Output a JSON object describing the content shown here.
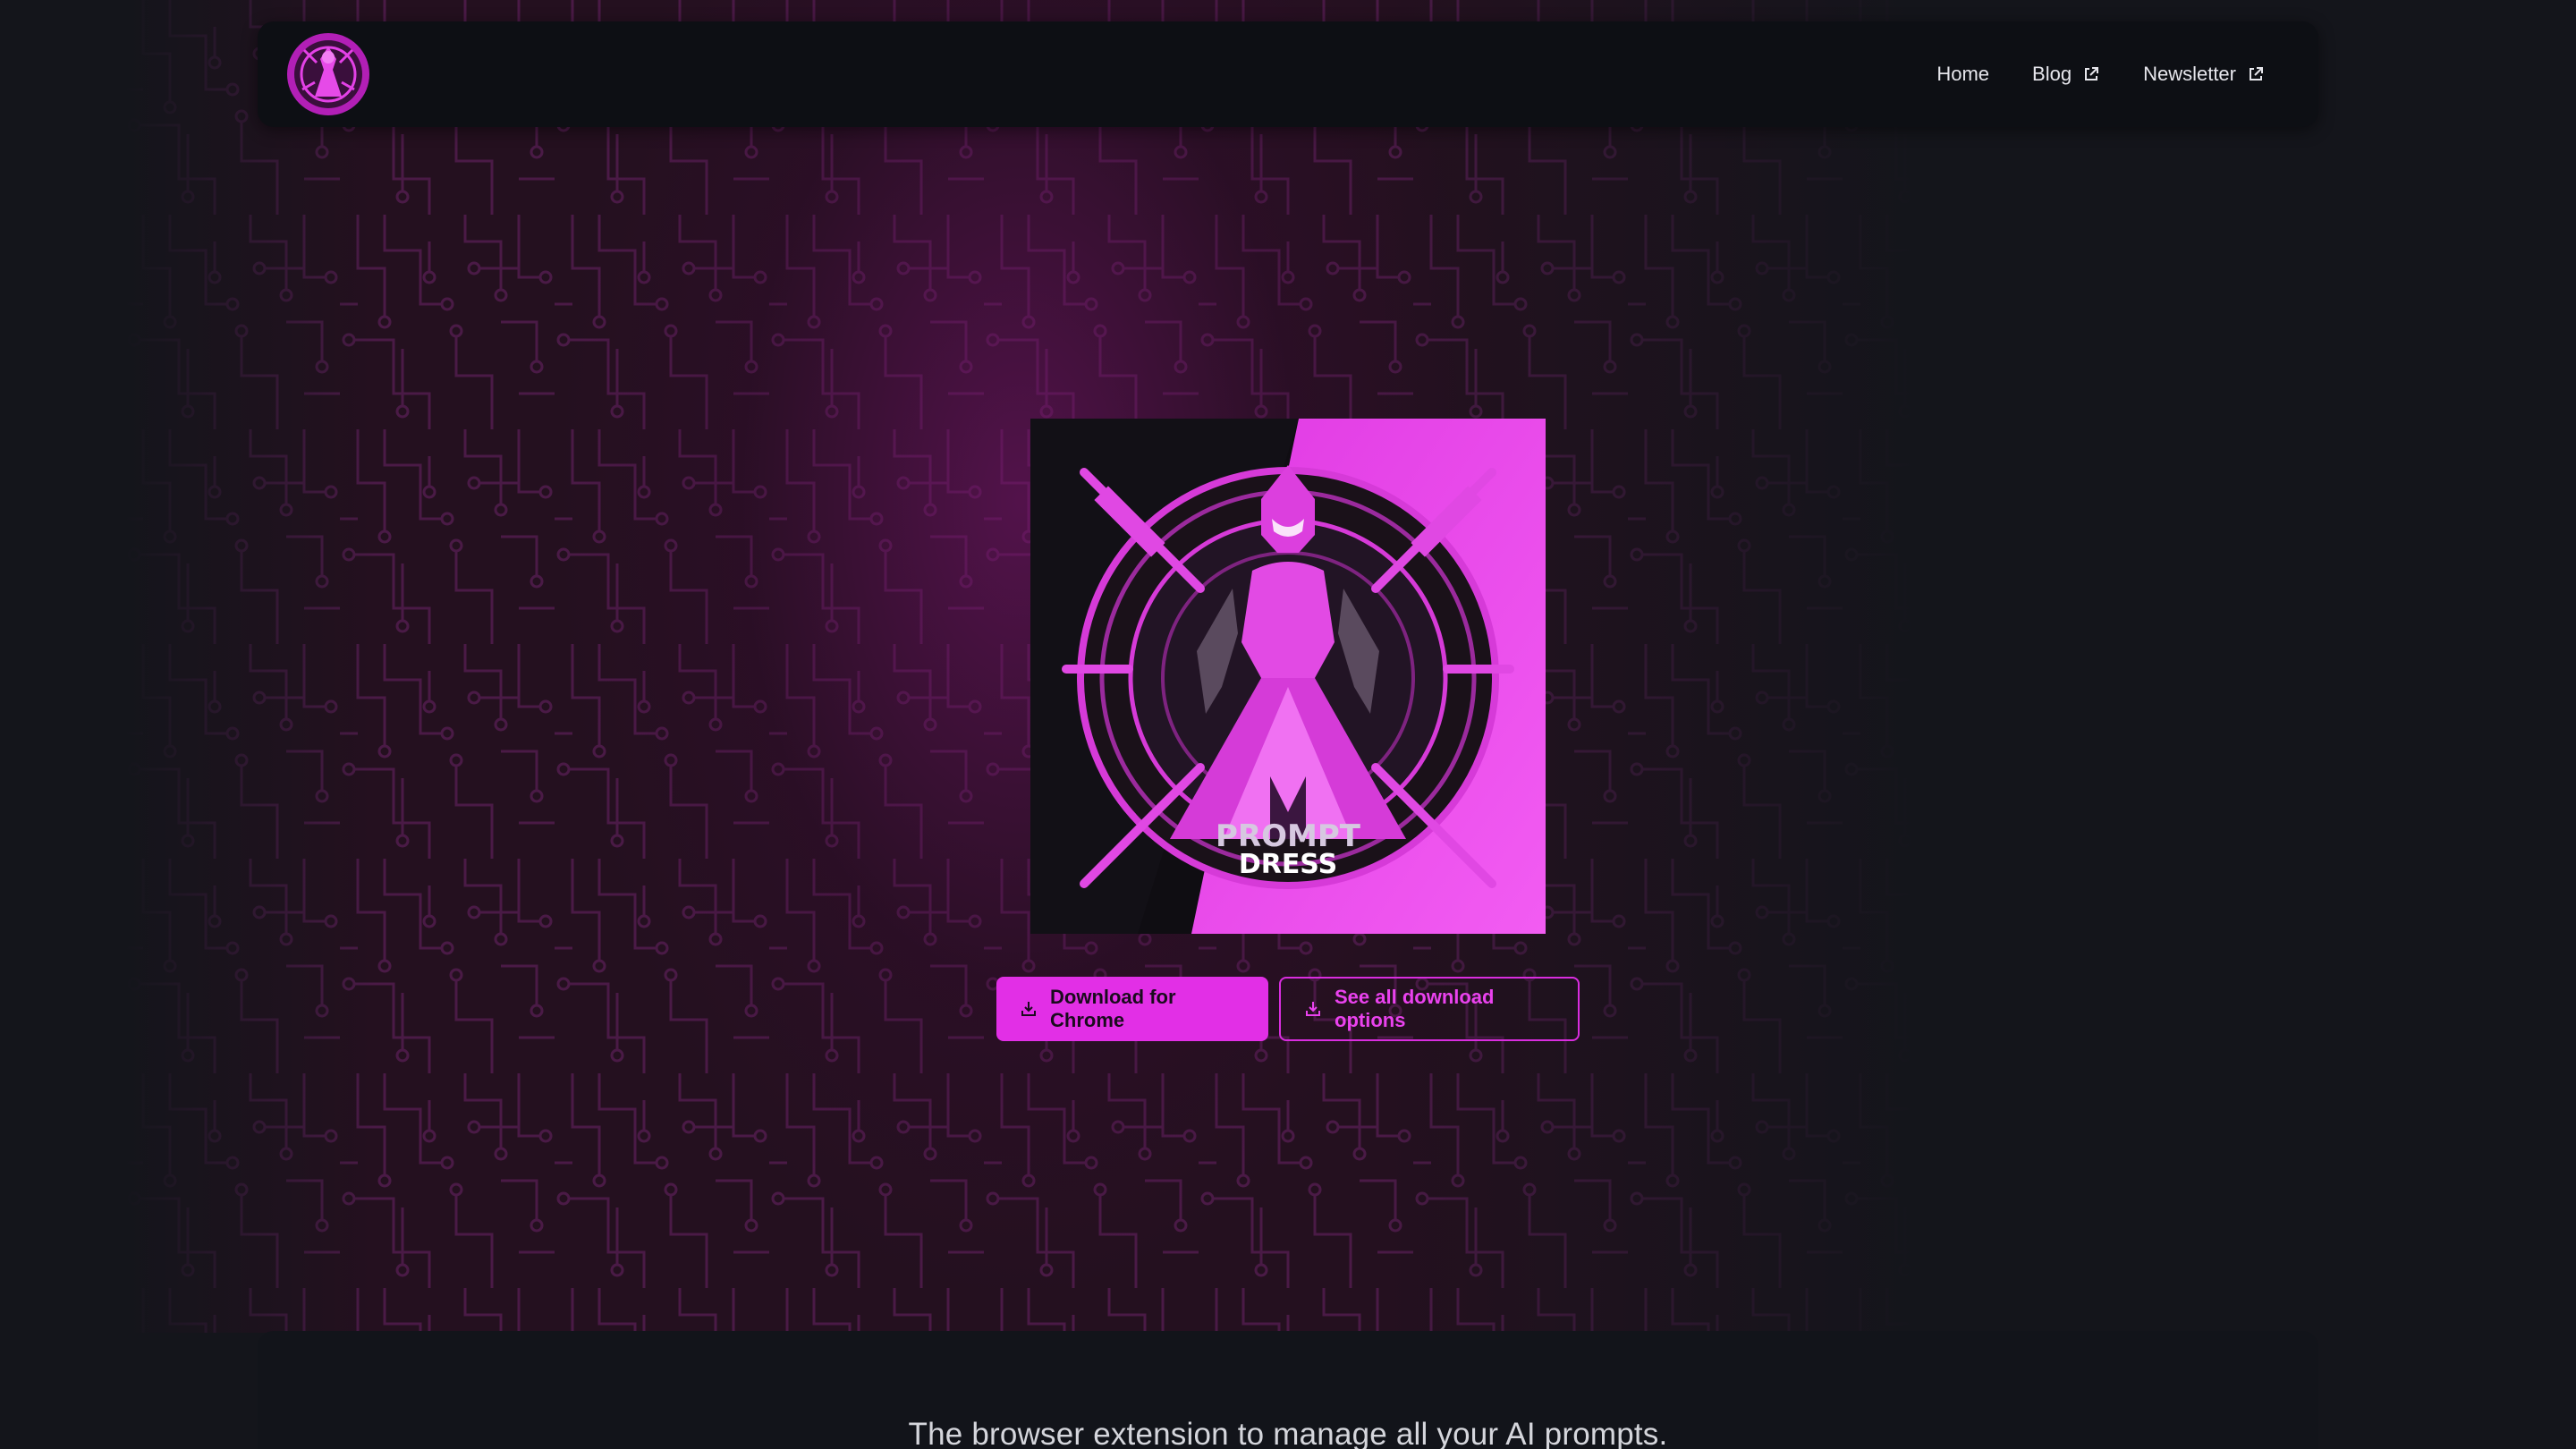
{
  "nav": {
    "logo_name": "prompt-dress-logo",
    "links": [
      {
        "label": "Home",
        "external": false
      },
      {
        "label": "Blog",
        "external": true
      },
      {
        "label": "Newsletter",
        "external": true
      }
    ]
  },
  "hero": {
    "image_text_line1": "PROMPT",
    "image_text_line2": "DRESS",
    "primary_button": "Download for Chrome",
    "secondary_button": "See all download options"
  },
  "info": {
    "tagline": "The browser extension to manage all your AI prompts."
  },
  "colors": {
    "accent": "#e22fe6",
    "background": "#14151b",
    "navbar": "#0d0f14",
    "circuit": "#3a1438"
  }
}
